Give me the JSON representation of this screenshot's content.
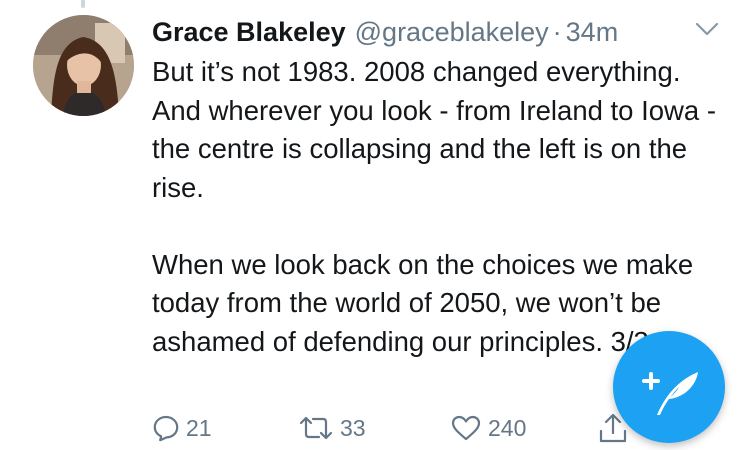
{
  "tweet": {
    "display_name": "Grace Blakeley",
    "handle": "@graceblakeley",
    "separator": "·",
    "time": "34m",
    "paragraphs": [
      "But it’s not 1983. 2008 changed everything. And wherever you look - from Ireland to Iowa - the centre is collapsing and the left is on the rise.",
      "When we look back on the choices we make today from the world of 2050, we won’t be ashamed of defending our principles. 3/3"
    ]
  },
  "actions": {
    "reply_count": "21",
    "retweet_count": "33",
    "like_count": "240"
  },
  "icons": {
    "reply": "reply-icon",
    "retweet": "retweet-icon",
    "like": "heart-icon",
    "share": "share-icon",
    "more": "chevron-down-icon",
    "compose": "compose-tweet-icon"
  },
  "colors": {
    "accent": "#1da1f2",
    "text": "#14171a",
    "secondary_text": "#657786"
  }
}
